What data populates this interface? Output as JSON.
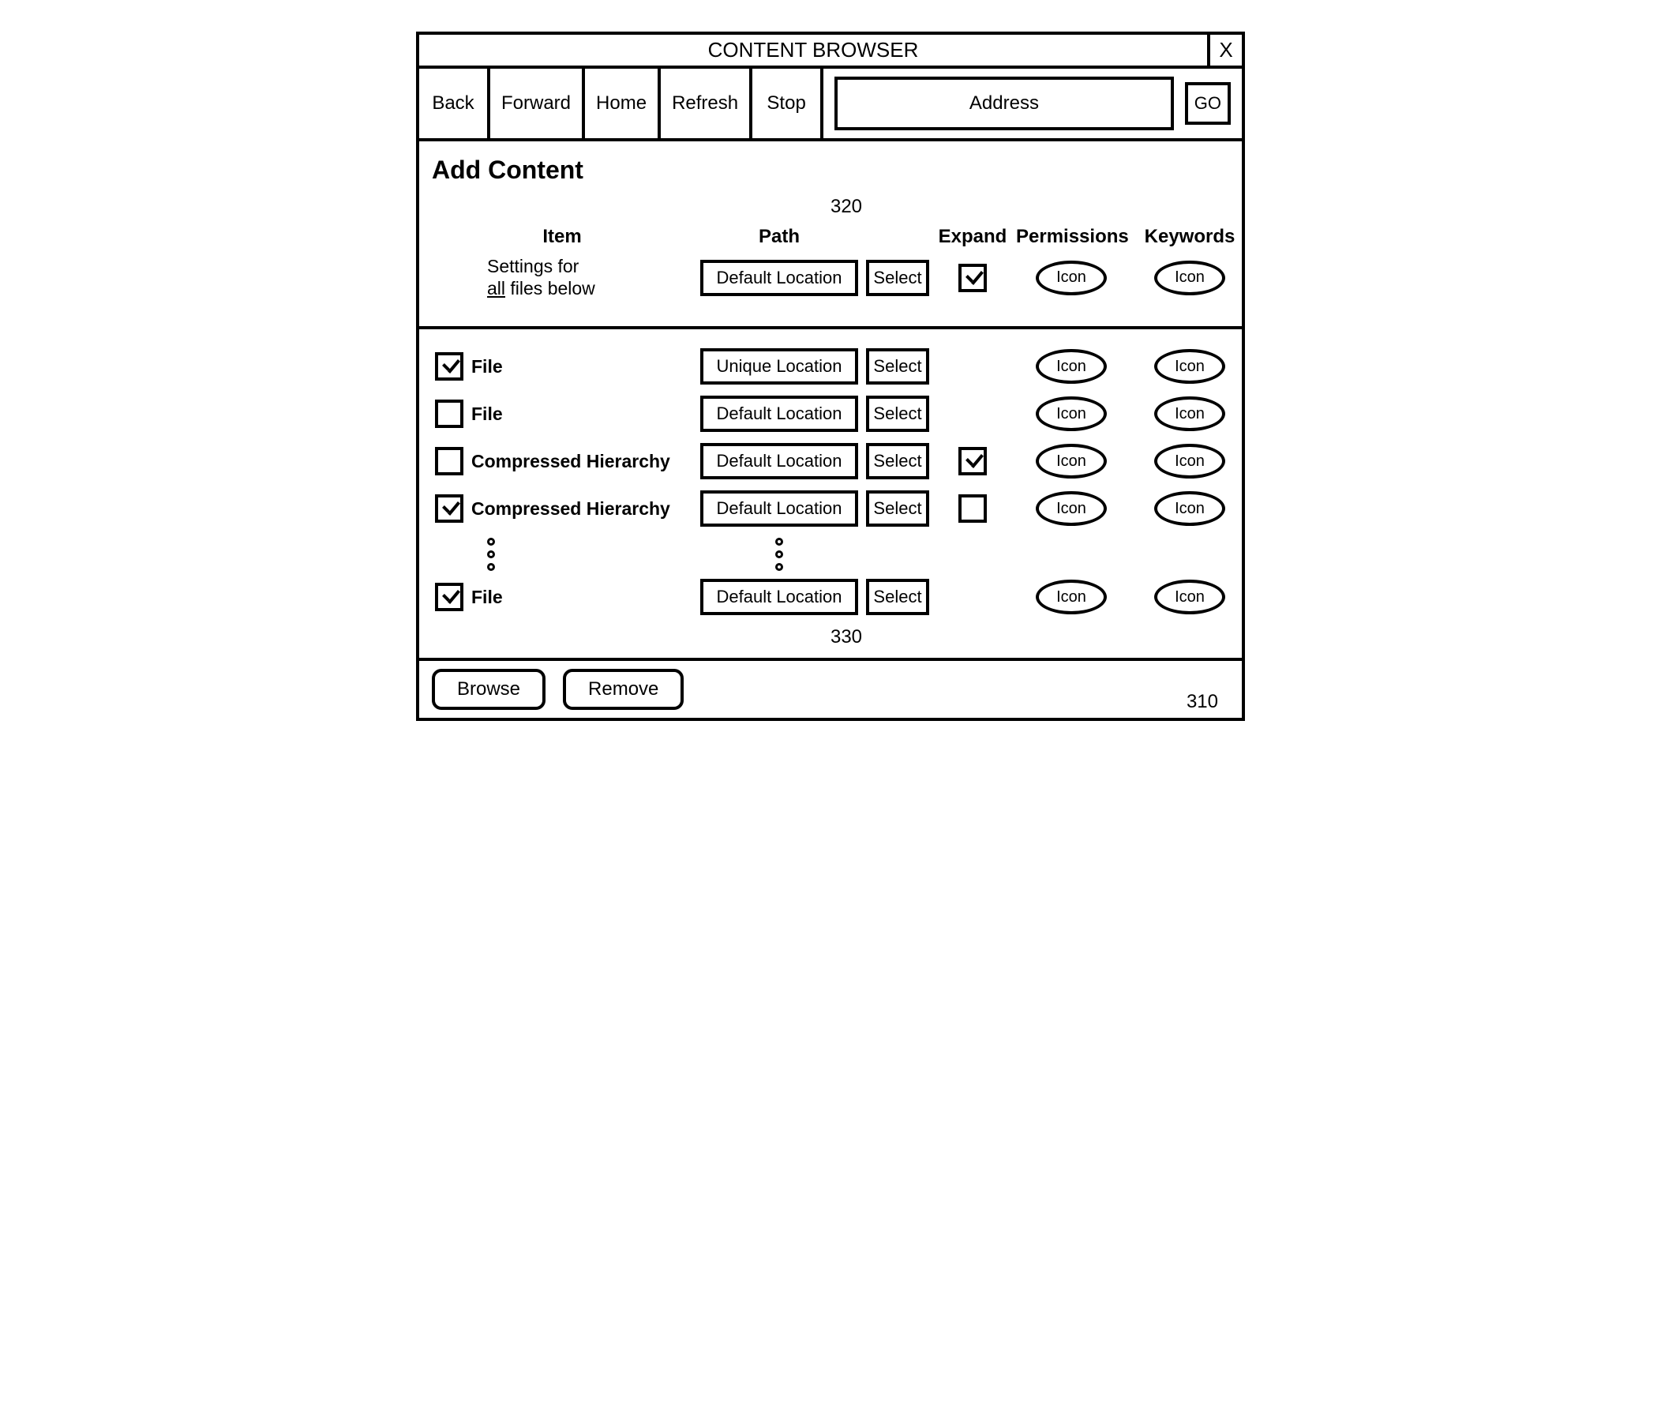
{
  "window": {
    "title": "CONTENT BROWSER",
    "close": "X"
  },
  "toolbar": {
    "back": "Back",
    "forward": "Forward",
    "home": "Home",
    "refresh": "Refresh",
    "stop": "Stop",
    "address_placeholder": "Address",
    "go": "GO"
  },
  "page": {
    "heading": "Add Content",
    "ref_top": "320",
    "ref_mid": "330",
    "ref_footer": "310"
  },
  "columns": {
    "item": "Item",
    "path": "Path",
    "expand": "Expand",
    "permissions": "Permissions",
    "keywords": "Keywords"
  },
  "settings_row": {
    "label_line1": "Settings for",
    "label_underline": "all",
    "label_suffix": " files below",
    "path": "Default Location",
    "select": "Select",
    "expand_checked": true,
    "permissions_icon": "Icon",
    "keywords_icon": "Icon"
  },
  "rows": [
    {
      "checked": true,
      "label": "File",
      "path": "Unique Location",
      "select": "Select",
      "expand": null,
      "permissions": "Icon",
      "keywords": "Icon"
    },
    {
      "checked": false,
      "label": "File",
      "path": "Default Location",
      "select": "Select",
      "expand": null,
      "permissions": "Icon",
      "keywords": "Icon"
    },
    {
      "checked": false,
      "label": "Compressed Hierarchy",
      "path": "Default Location",
      "select": "Select",
      "expand": true,
      "permissions": "Icon",
      "keywords": "Icon"
    },
    {
      "checked": true,
      "label": "Compressed Hierarchy",
      "path": "Default Location",
      "select": "Select",
      "expand": false,
      "permissions": "Icon",
      "keywords": "Icon"
    }
  ],
  "last_row": {
    "checked": true,
    "label": "File",
    "path": "Default Location",
    "select": "Select",
    "expand": null,
    "permissions": "Icon",
    "keywords": "Icon"
  },
  "footer": {
    "browse": "Browse",
    "remove": "Remove"
  }
}
